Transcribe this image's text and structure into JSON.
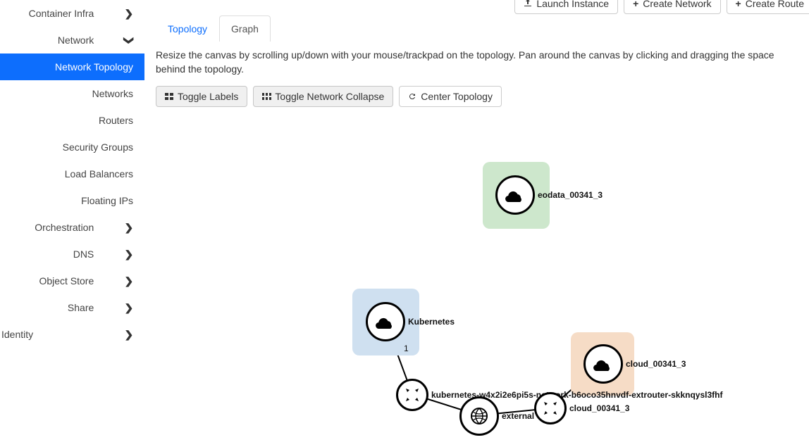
{
  "sidebar": {
    "items": [
      {
        "label": "Container Infra",
        "type": "top",
        "chev": "right"
      },
      {
        "label": "Network",
        "type": "top",
        "chev": "down",
        "expanded": true
      },
      {
        "label": "Network Topology",
        "type": "sub",
        "active": true
      },
      {
        "label": "Networks",
        "type": "sub"
      },
      {
        "label": "Routers",
        "type": "sub"
      },
      {
        "label": "Security Groups",
        "type": "sub"
      },
      {
        "label": "Load Balancers",
        "type": "sub"
      },
      {
        "label": "Floating IPs",
        "type": "sub"
      },
      {
        "label": "Orchestration",
        "type": "top",
        "chev": "right"
      },
      {
        "label": "DNS",
        "type": "top",
        "chev": "right"
      },
      {
        "label": "Object Store",
        "type": "top",
        "chev": "right"
      },
      {
        "label": "Share",
        "type": "top",
        "chev": "right"
      },
      {
        "label": "Identity",
        "type": "top",
        "chev": "right",
        "flush": true
      }
    ]
  },
  "top_buttons": {
    "launch_instance": "Launch Instance",
    "create_network": "Create Network",
    "create_router": "Create Route"
  },
  "tabs": {
    "topology": "Topology",
    "graph": "Graph"
  },
  "hint": "Resize the canvas by scrolling up/down with your mouse/trackpad on the topology. Pan around the canvas by clicking and dragging the space behind the topology.",
  "toolbar": {
    "toggle_labels": "Toggle Labels",
    "toggle_network_collapse": "Toggle Network Collapse",
    "center_topology": "Center Topology"
  },
  "graph": {
    "nodes": {
      "eodata": {
        "label": "eodata_00341_3"
      },
      "kubernetes": {
        "label": "Kubernetes",
        "badge": "1"
      },
      "cloud": {
        "label": "cloud_00341_3"
      },
      "router_kube": {
        "label": "kubernetes-w4x2i2e6pi5s-network-b6oco35hnvdf-extrouter-skknqysl3fhf"
      },
      "router_cloud": {
        "label": "cloud_00341_3"
      },
      "external": {
        "label": "external"
      }
    }
  }
}
